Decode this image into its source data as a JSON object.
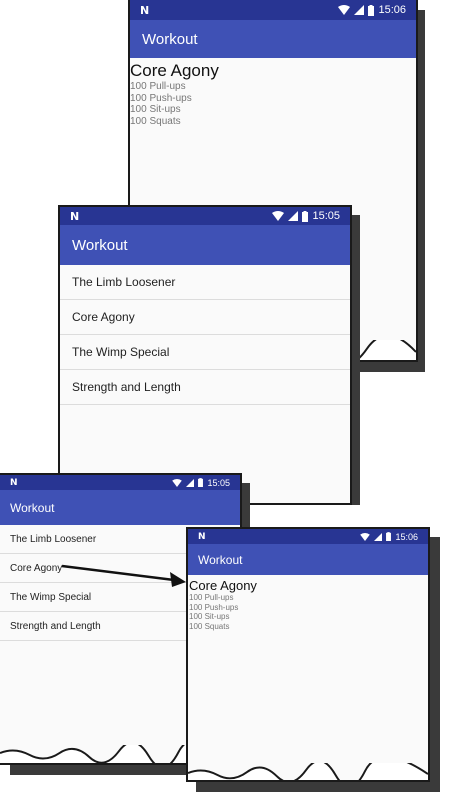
{
  "screens": {
    "top_detail": {
      "time": "15:06",
      "app_title": "Workout",
      "workout_name": "Core Agony",
      "exercises": [
        "100 Pull-ups",
        "100 Push-ups",
        "100 Sit-ups",
        "100 Squats"
      ]
    },
    "middle_list": {
      "time": "15:05",
      "app_title": "Workout",
      "workouts": [
        "The Limb Loosener",
        "Core Agony",
        "The Wimp Special",
        "Strength and Length"
      ]
    },
    "bottom_list": {
      "time": "15:05",
      "app_title": "Workout",
      "workouts": [
        "The Limb Loosener",
        "Core Agony",
        "The Wimp Special",
        "Strength and Length"
      ]
    },
    "bottom_detail": {
      "time": "15:06",
      "app_title": "Workout",
      "workout_name": "Core Agony",
      "exercises": [
        "100 Pull-ups",
        "100 Push-ups",
        "100 Sit-ups",
        "100 Squats"
      ]
    }
  },
  "icons": [
    "notification-n-icon",
    "wifi-icon",
    "signal-icon",
    "battery-icon",
    "arrow-icon"
  ],
  "colors": {
    "status_bar": "#283593",
    "app_bar": "#3f51b5",
    "background": "#fafafa"
  }
}
